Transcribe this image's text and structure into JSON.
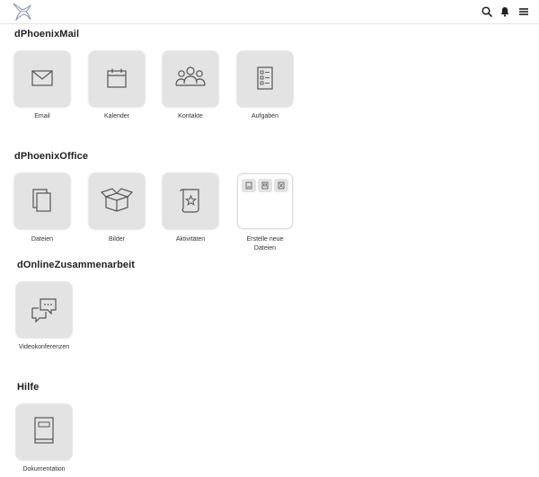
{
  "header": {
    "logo_icon": "phoenix-bird-icon",
    "actions": [
      {
        "name": "search",
        "icon": "search-icon"
      },
      {
        "name": "notifications",
        "icon": "bell-icon"
      },
      {
        "name": "menu",
        "icon": "hamburger-menu-icon"
      }
    ]
  },
  "sections": [
    {
      "title": "dPhoenixMail",
      "apps": [
        {
          "label": "Email",
          "icon": "envelope-icon"
        },
        {
          "label": "Kalender",
          "icon": "calendar-icon"
        },
        {
          "label": "Kontakte",
          "icon": "contacts-group-icon"
        },
        {
          "label": "Aufgaben",
          "icon": "task-checklist-icon"
        }
      ]
    },
    {
      "title": "dPhoenixOffice",
      "apps": [
        {
          "label": "Dateien",
          "icon": "files-icon"
        },
        {
          "label": "Bilder",
          "icon": "open-box-icon"
        },
        {
          "label": "Aktivitäten",
          "icon": "star-scroll-icon"
        },
        {
          "label": "Erstelle neue Dateien",
          "label_line1": "Erstelle neue",
          "label_line2": "Dateien",
          "icon": "new-file-panel",
          "sub_icons": [
            "image-file-icon",
            "presentation-file-icon",
            "spreadsheet-file-icon"
          ]
        }
      ]
    },
    {
      "title": "dOnlineZusammenarbeit",
      "apps": [
        {
          "label": "Videokonferenzen",
          "icon": "chat-bubbles-icon"
        }
      ]
    },
    {
      "title": "Hilfe",
      "apps": [
        {
          "label": "Dokumentation",
          "icon": "book-icon"
        }
      ]
    }
  ],
  "colors": {
    "tile_background": "#e3e3e3",
    "icon_stroke": "#555555",
    "text": "#222222"
  }
}
